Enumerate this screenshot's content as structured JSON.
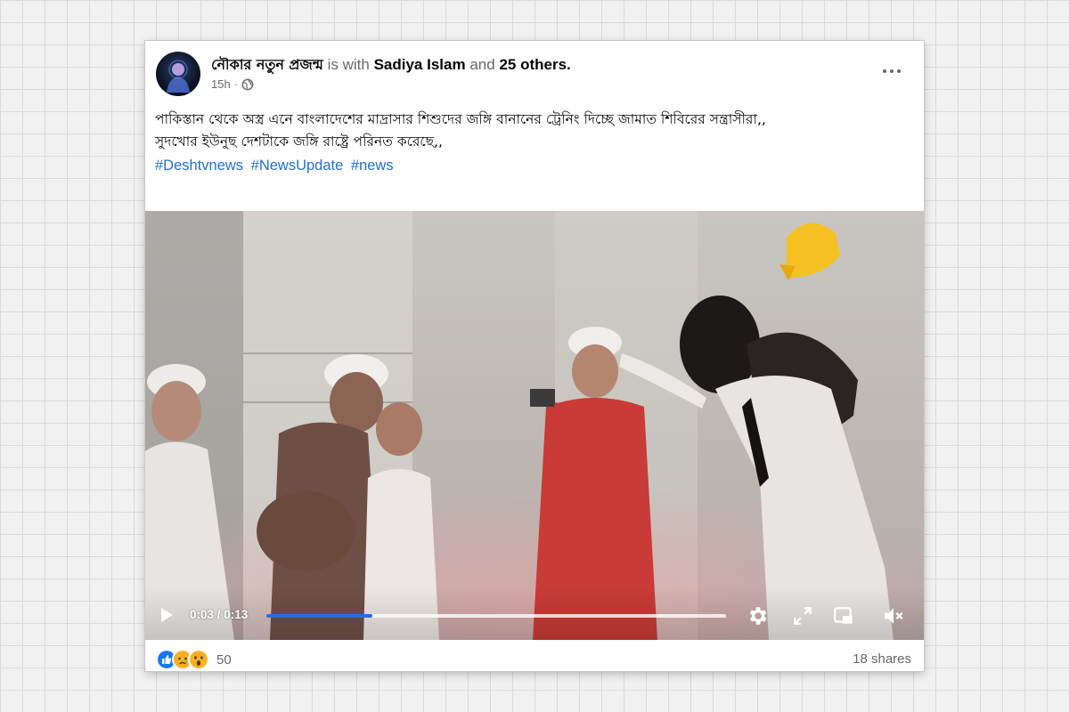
{
  "post": {
    "page_name": "নৌকার নতুন প্রজন্ম",
    "is_with": "is with",
    "tagged_user": "Sadiya Islam",
    "and_text": "and",
    "others": "25 others.",
    "time_ago": "15h",
    "text_line1": "পাকিস্তান থেকে অস্ত্র এনে বাংলাদেশের মাদ্রাসার শিশুদের জঙ্গি বানানের ট্রেনিং দিচ্ছে জামাত শিবিরের সন্ত্রাসীরা,,",
    "text_line2": "সুদখোর ইউনুছ দেশটাকে জঙ্গি রাষ্ট্রে পরিনত করেছে,,",
    "hashtags": [
      "#Deshtvnews",
      "#NewsUpdate",
      "#news"
    ]
  },
  "video": {
    "current_time": "0:03",
    "separator": " / ",
    "duration": "0:13",
    "progress": 0.23
  },
  "footer": {
    "reaction_count": "50",
    "shares": "18 shares"
  },
  "icons": {
    "avatar": "avatar",
    "globe": "globe-icon",
    "more": "more-options-icon",
    "play": "play-icon",
    "settings": "settings-icon",
    "fullscreen": "fullscreen-icon",
    "pip": "picture-in-picture-icon",
    "mute": "mute-icon",
    "reactions": [
      "like-icon",
      "sad-icon",
      "wow-icon"
    ]
  },
  "colors": {
    "hashtag": "#216fdb",
    "progress": "#2d6ce0",
    "like": "#1877f2",
    "sad": "#f7b125"
  }
}
